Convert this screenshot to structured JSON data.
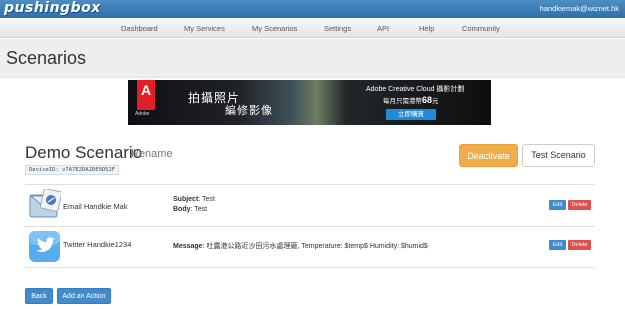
{
  "topbar": {
    "logo": "pushingbox",
    "user": "handkiemak@wiznet.hk"
  },
  "nav": [
    "Dashboard",
    "My Services",
    "My Scenarios",
    "Settings",
    "API",
    "Help",
    "Community"
  ],
  "page": {
    "title": "Scenarios"
  },
  "banner": {
    "brand_mark": "A",
    "brand": "Adobe",
    "line1": "拍攝照片",
    "line2": "編修影像",
    "line3": "Adobe Creative Cloud 攝影計劃",
    "line4_prefix": "每月只需港幣",
    "line4_price": "68",
    "line4_suffix": "元",
    "cta": "立即購買"
  },
  "scenario": {
    "title": "Demo Scenario",
    "rename": "Rename",
    "device_id": "DeviceID: v7A7E2DA2DE9D52F",
    "deactivate": "Deactivate",
    "test": "Test Scenario"
  },
  "actions": [
    {
      "name": "Email Handkie Mak",
      "icon": "mail-app-icon",
      "fields": [
        {
          "label": "Subject",
          "value": ": Test"
        },
        {
          "label": "Body",
          "value": ": Test"
        }
      ],
      "edit": "Edit",
      "delete": "Delete"
    },
    {
      "name": "Twitter Handkie1234",
      "icon": "twitter-bird-icon",
      "fields": [
        {
          "label": "Message",
          "value": ": 吐露港公路近沙田污水處理廠, Temperature: $temp$ Humidity: $humid$"
        }
      ],
      "edit": "Edit",
      "delete": "Delete"
    }
  ],
  "footer": {
    "back": "Back",
    "add": "Add an Action"
  },
  "colors": {
    "topbar": "#2f6ea8",
    "warning": "#f0ad4e",
    "primary": "#428bca",
    "danger": "#d9534f"
  }
}
